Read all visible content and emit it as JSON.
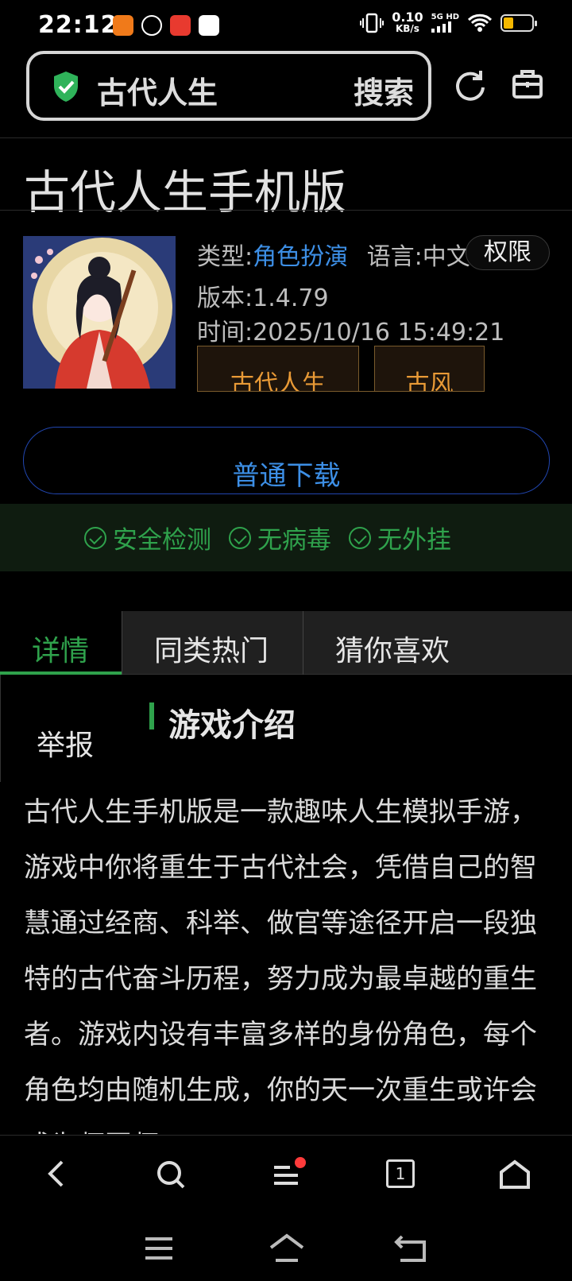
{
  "status_bar": {
    "time": "22:12",
    "net_speed_value": "0.10",
    "net_speed_unit": "KB/s",
    "network": "5G HD",
    "battery_level": 0.25,
    "battery_color": "#f5b800"
  },
  "search": {
    "query": "古代人生",
    "button": "搜索"
  },
  "page": {
    "title": "古代人生手机版"
  },
  "app": {
    "type_label": "类型:",
    "type_value": "角色扮演",
    "lang_label": "语言:",
    "lang_value": "中文",
    "version": "版本:1.4.79",
    "time": "时间:2025/10/16 15:49:21",
    "permission_button": "权限",
    "tags": [
      "古代人生",
      "古风"
    ],
    "download_button": "普通下载"
  },
  "safety": {
    "items": [
      "安全检测",
      "无病毒",
      "无外挂"
    ]
  },
  "tabs": {
    "items": [
      "详情",
      "同类热门",
      "猜你喜欢"
    ],
    "active": 0,
    "report": "举报"
  },
  "section": {
    "title": "游戏介绍",
    "body": "古代人生手机版是一款趣味人生模拟手游，游戏中你将重生于古代社会，凭借自己的智慧通过经商、科举、做官等途径开启一段独特的古代奋斗历程，努力成为最卓越的重生者。游戏内设有丰富多样的身份角色，每个角色均由随机生成，你的天一次重生或许会成为师团师"
  },
  "colors": {
    "accent_green": "#2fa24c",
    "link_blue": "#3d8fe6",
    "tag_orange": "#e99a36",
    "notification_red": "#ff3b3b"
  },
  "icons": {
    "bottom_nav": [
      "back-icon",
      "search-icon",
      "menu-icon",
      "tabs-icon",
      "home-icon"
    ],
    "system_nav": [
      "recents-icon",
      "home-icon",
      "back-icon"
    ],
    "tab_count": "1"
  }
}
